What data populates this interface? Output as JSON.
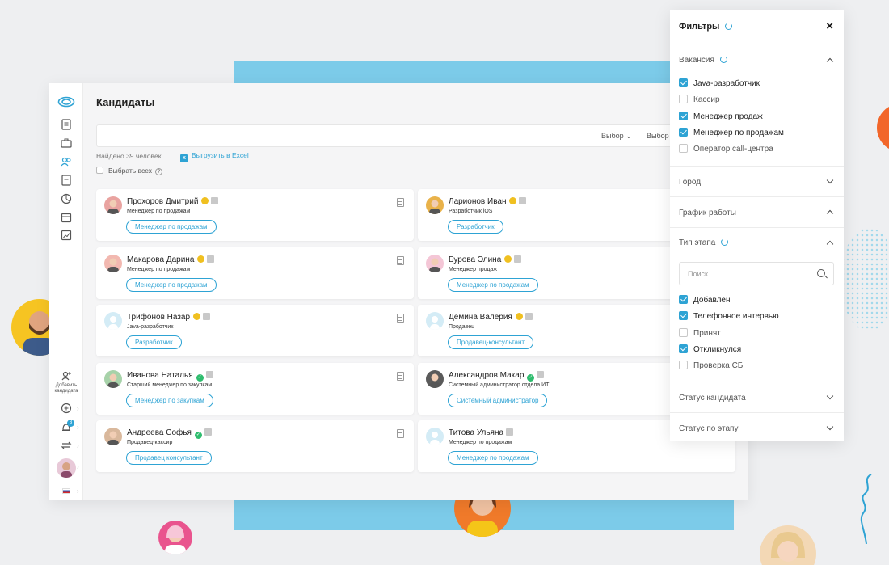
{
  "app": {
    "page_title": "Кандидаты",
    "select_labels": [
      "Выбор",
      "Выбор"
    ],
    "found_text": "Найдено 39 человек",
    "export_label": "Выгрузить в Excel",
    "select_all_label": "Выбрать всех",
    "add_candidate_label": "Добавить кандидата",
    "notification_count": "3"
  },
  "candidates": [
    {
      "name": "Прохоров Дмитрий",
      "role": "Менеджер по продажам",
      "tag": "Менеджер по продажам",
      "badge": "yellow"
    },
    {
      "name": "Ларионов Иван",
      "role": "Разработчик iOS",
      "tag": "Разработчик",
      "badge": "yellow"
    },
    {
      "name": "Макарова Дарина",
      "role": "Менеджер по продажам",
      "tag": "Менеджер по продажам",
      "badge": "yellow"
    },
    {
      "name": "Бурова Элина",
      "role": "Менеджер продаж",
      "tag": "Менеджер по продажам",
      "badge": "yellow"
    },
    {
      "name": "Трифонов Назар",
      "role": "Java-разработчик",
      "tag": "Разработчик",
      "badge": "yellow"
    },
    {
      "name": "Демина Валерия",
      "role": "Продавец",
      "tag": "Продавец-консультант",
      "badge": "yellow"
    },
    {
      "name": "Иванова Наталья",
      "role": "Старший менеджер по закупкам",
      "tag": "Менеджер по закупкам",
      "badge": "green"
    },
    {
      "name": "Александров Макар",
      "role": "Системный администратор отдела ИТ",
      "tag": "Системный администратор",
      "badge": "green"
    },
    {
      "name": "Андреева Софья",
      "role": "Продавец-кассир",
      "tag": "Продавец консультант",
      "badge": "green"
    },
    {
      "name": "Титова Ульяна",
      "role": "Менеджер по продажам",
      "tag": "Менеджер по продажам",
      "badge": "none"
    }
  ],
  "filters": {
    "title": "Фильтры",
    "vacancies": {
      "title": "Вакансия",
      "options": [
        {
          "label": "Java-разработчик",
          "checked": true
        },
        {
          "label": "Кассир",
          "checked": false
        },
        {
          "label": "Менеджер продаж",
          "checked": true
        },
        {
          "label": "Менеджер по продажам",
          "checked": true
        },
        {
          "label": "Оператор call-центра",
          "checked": false
        }
      ]
    },
    "city": "Город",
    "schedule": "График работы",
    "stage_type": {
      "title": "Тип этапа",
      "search_placeholder": "Поиск",
      "options": [
        {
          "label": "Добавлен",
          "checked": true
        },
        {
          "label": "Телефонное интервью",
          "checked": true
        },
        {
          "label": "Принят",
          "checked": false
        },
        {
          "label": "Откликнулся",
          "checked": true
        },
        {
          "label": "Проверка СБ",
          "checked": false
        }
      ]
    },
    "candidate_status": "Статус кандидата",
    "stage_status": "Статус по этапу"
  },
  "colors": {
    "accent": "#2ea3d4",
    "checked_yellow": "#f0c020",
    "checked_green": "#2ebd6e",
    "deco_blue": "#7ccbe9"
  }
}
